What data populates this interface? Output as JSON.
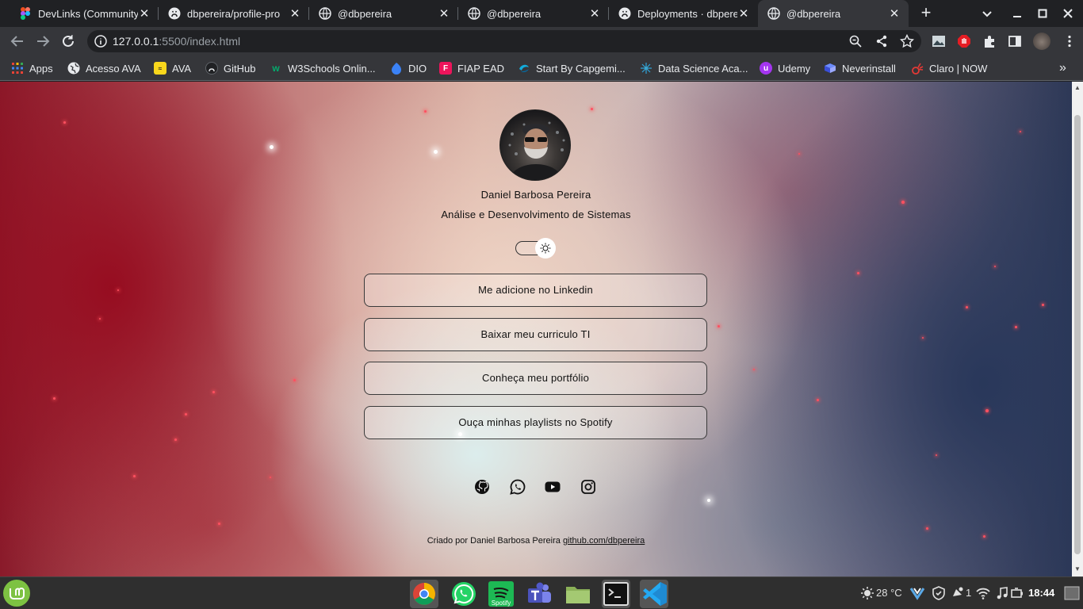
{
  "browser": {
    "tabs": [
      {
        "title": "DevLinks (Community",
        "favicon": "figma-icon"
      },
      {
        "title": "dbpereira/profile-pro",
        "favicon": "github-icon"
      },
      {
        "title": "@dbpereira",
        "favicon": "globe-icon"
      },
      {
        "title": "@dbpereira",
        "favicon": "globe-icon"
      },
      {
        "title": "Deployments · dbpere",
        "favicon": "github-icon"
      },
      {
        "title": "@dbpereira",
        "favicon": "globe-icon"
      }
    ],
    "active_tab": 5,
    "url_host": "127.0.0.1",
    "url_path": ":5500/index.html",
    "bookmarks": [
      {
        "label": "Apps",
        "icon": "apps-grid-icon"
      },
      {
        "label": "Acesso AVA",
        "icon": "globe-icon"
      },
      {
        "label": "AVA",
        "icon": "ava-icon"
      },
      {
        "label": "GitHub",
        "icon": "github-icon"
      },
      {
        "label": "W3Schools Onlin...",
        "icon": "w3schools-icon"
      },
      {
        "label": "DIO",
        "icon": "dio-icon"
      },
      {
        "label": "FIAP EAD",
        "icon": "fiap-icon"
      },
      {
        "label": "Start By Capgemi...",
        "icon": "capgemini-icon"
      },
      {
        "label": "Data Science Aca...",
        "icon": "datascience-icon"
      },
      {
        "label": "Udemy",
        "icon": "udemy-icon"
      },
      {
        "label": "Neverinstall",
        "icon": "neverinstall-icon"
      },
      {
        "label": "Claro | NOW",
        "icon": "claro-icon"
      }
    ],
    "more_bookmarks": "»"
  },
  "page": {
    "name": "Daniel Barbosa Pereira",
    "role": "Análise e Desenvolvimento de Sistemas",
    "theme_toggle": "light",
    "links": [
      "Me adicione no Linkedin",
      "Baixar meu curriculo TI",
      "Conheça meu portfólio",
      "Ouça minhas playlists no Spotify"
    ],
    "social": [
      "github-icon",
      "whatsapp-icon",
      "youtube-icon",
      "instagram-icon"
    ],
    "footer_text": "Criado por Daniel Barbosa Pereira",
    "footer_link": "github.com/dbpereira"
  },
  "taskbar": {
    "apps": [
      "chrome-icon",
      "whatsapp-icon",
      "spotify-icon",
      "teams-icon",
      "files-icon",
      "terminal-icon",
      "vscode-icon"
    ],
    "spotify_label": "Spotify",
    "temperature": "28 °C",
    "notifications": "1",
    "clock": "18:44"
  }
}
